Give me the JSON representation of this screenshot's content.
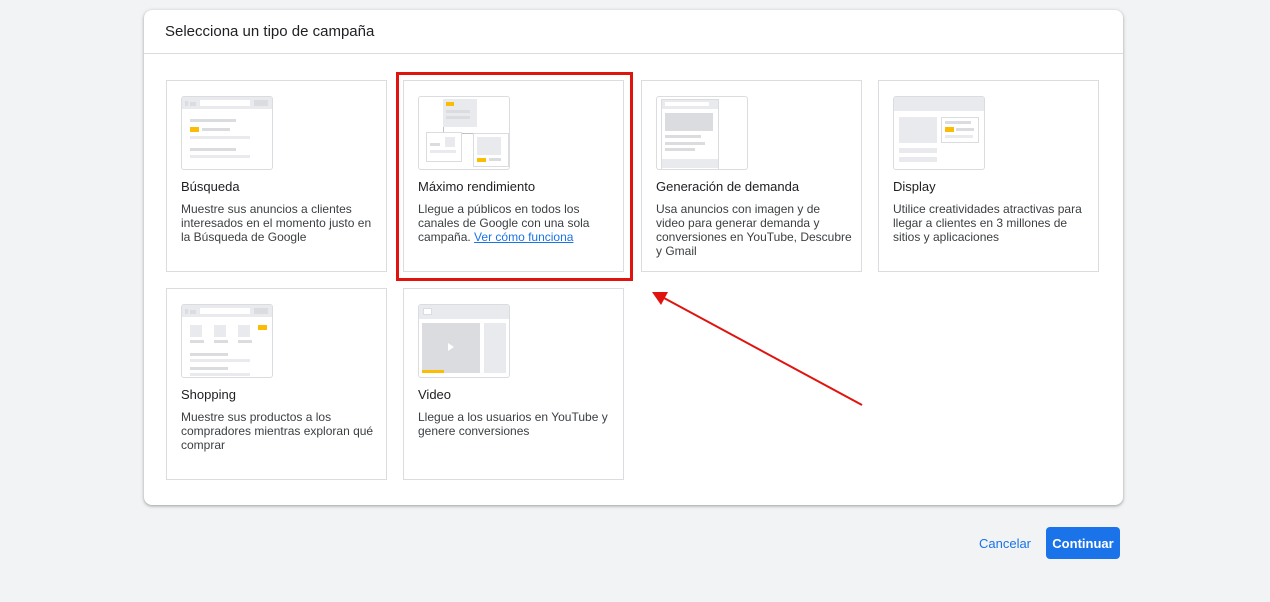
{
  "dialog": {
    "title": "Selecciona un tipo de campaña"
  },
  "cards": [
    {
      "title": "Búsqueda",
      "description": "Muestre sus anuncios a clientes interesados en el momento justo en la Búsqueda de Google",
      "illustration": "search-illustration-icon"
    },
    {
      "title": "Máximo rendimiento",
      "description": "Llegue a públicos en todos los canales de Google con una sola campaña.",
      "link": "Ver cómo funciona",
      "illustration": "performance-max-illustration-icon",
      "selected": true
    },
    {
      "title": "Generación de demanda",
      "description": "Usa anuncios con imagen y de video para generar demanda y conversiones en YouTube, Descubre y Gmail",
      "illustration": "demand-gen-illustration-icon"
    },
    {
      "title": "Display",
      "description": "Utilice creatividades atractivas para llegar a clientes en 3 millones de sitios y aplicaciones",
      "illustration": "display-illustration-icon"
    },
    {
      "title": "Shopping",
      "description": "Muestre sus productos a los compradores mientras exploran qué comprar",
      "illustration": "shopping-illustration-icon"
    },
    {
      "title": "Video",
      "description": "Llegue a los usuarios en YouTube y genere conversiones",
      "illustration": "video-illustration-icon"
    }
  ],
  "footer": {
    "cancel_label": "Cancelar",
    "continue_label": "Continuar"
  },
  "colors": {
    "accent": "#1a73e8",
    "annotation": "#e0140f",
    "illustration_yellow": "#fbbc04"
  }
}
